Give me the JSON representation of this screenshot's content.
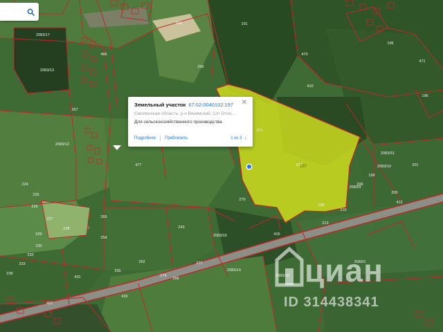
{
  "search": {
    "icon": "search-icon"
  },
  "popup": {
    "title": "Земельный участок",
    "cadastral_number": "67:02:0040102:197",
    "address": "Смоленская область, р-н Вяземский, С/п Относовск...",
    "land_use": "Для сельскохозяйственного производства",
    "details_link": "Подробнее",
    "zoom_link": "Приблизить",
    "pager": "1 из 3",
    "close_icon": "close-icon",
    "next_icon": "chevron-right-icon"
  },
  "selected_parcel": {
    "label": "197",
    "fill_color": "#d2e01d"
  },
  "parcel_labels": [
    "2083/17",
    "2083/13",
    "2083/12",
    "2083/15",
    "2083/14",
    "2083/18",
    "2083/1",
    "2083/10",
    "2083/31",
    "2083/3",
    "191",
    "195",
    "196",
    "197",
    "198",
    "199",
    "200",
    "201",
    "206",
    "210",
    "213",
    "224",
    "225",
    "226",
    "227",
    "228",
    "229",
    "230",
    "232",
    "233",
    "239",
    "243",
    "250",
    "251",
    "254",
    "255",
    "256",
    "259",
    "262",
    "265",
    "267",
    "270",
    "271",
    "274",
    "277",
    "410",
    "412",
    "415",
    "427",
    "429",
    "431",
    "466",
    "470",
    "471",
    "477"
  ],
  "watermark": {
    "brand": "циан",
    "listing_id": "ID 314438341"
  },
  "colors": {
    "boundary": "#c0282a",
    "field_green": "#4d7a3e",
    "forest": "#2b4a25"
  }
}
